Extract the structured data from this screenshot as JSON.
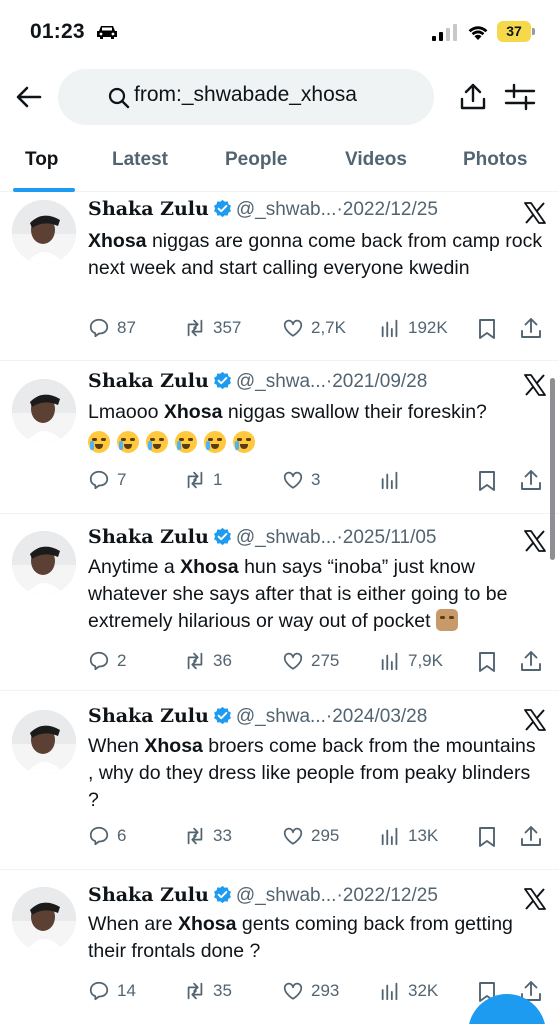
{
  "status_bar": {
    "time": "01:23",
    "battery": "37"
  },
  "search": {
    "query": "from:_shwabade_xhosa"
  },
  "tabs": [
    "Top",
    "Latest",
    "People",
    "Videos",
    "Photos"
  ],
  "tweets": [
    {
      "name": "Sհaka Zulu",
      "handle": "@_shwab...",
      "sep": "·",
      "date": "2022/12/25",
      "text_parts": [
        {
          "b": "Xhosa"
        },
        {
          "t": " niggas are gonna come back from camp rock next week and start calling everyone kwedin"
        }
      ],
      "replies": "87",
      "reposts": "357",
      "likes": "2,7K",
      "views": "192K"
    },
    {
      "name": "Sհaka Zulu",
      "handle": "@_shwa...",
      "sep": "·",
      "date": "2021/09/28",
      "text_parts": [
        {
          "t": "Lmaooo "
        },
        {
          "b": "Xhosa"
        },
        {
          "t": " niggas swallow their foreskin?"
        }
      ],
      "emojis": [
        "loudly-crying-face",
        "loudly-crying-face",
        "loudly-crying-face",
        "loudly-crying-face",
        "loudly-crying-face",
        "rolling-on-floor-laughing"
      ],
      "replies": "7",
      "reposts": "1",
      "likes": "3",
      "views": ""
    },
    {
      "name": "Sհaka Zulu",
      "handle": "@_shwab...",
      "sep": "·",
      "date": "2025/11/05",
      "text_parts": [
        {
          "t": "Anytime a "
        },
        {
          "b": "Xhosa"
        },
        {
          "t": " hun says “inoba” just know whatever she says after that is either going to be extremely hilarious or way out of pocket"
        }
      ],
      "emojis_trailing": [
        "crossed-fingers"
      ],
      "replies": "2",
      "reposts": "36",
      "likes": "275",
      "views": "7,9K"
    },
    {
      "name": "Sհaka Zulu",
      "handle": "@_shwa...",
      "sep": "·",
      "date": "2024/03/28",
      "text_parts": [
        {
          "t": "When "
        },
        {
          "b": "Xhosa"
        },
        {
          "t": " broers come back from the mountains , why do they dress like people from peaky blinders ?"
        }
      ],
      "replies": "6",
      "reposts": "33",
      "likes": "295",
      "views": "13K"
    },
    {
      "name": "Sհaka Zulu",
      "handle": "@_shwab...",
      "sep": "·",
      "date": "2022/12/25",
      "text_parts": [
        {
          "t": "When are "
        },
        {
          "b": "Xhosa"
        },
        {
          "t": " gents coming back from getting their frontals done ?"
        }
      ],
      "replies": "14",
      "reposts": "35",
      "likes": "293",
      "views": "32K"
    }
  ],
  "colors": {
    "accent": "#1d9bf0",
    "text": "#0f1419",
    "muted": "#536471",
    "battery": "#f6d94a"
  }
}
